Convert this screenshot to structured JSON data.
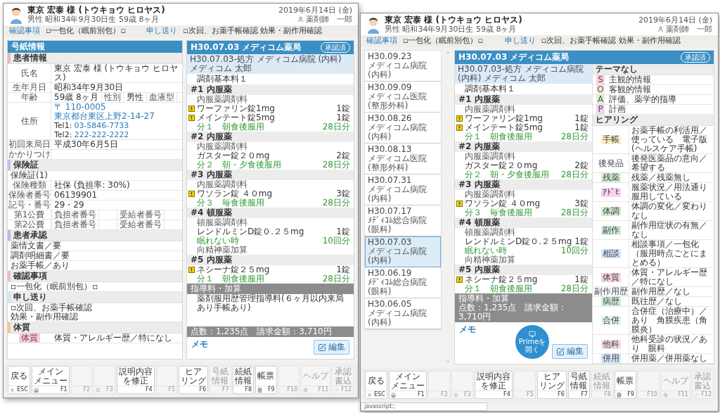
{
  "windows": [
    {
      "kind": "detail",
      "header": {
        "name": "東京 宏泰 様 (トウキョウ ヒロヤス)",
        "info": "男性 昭和34年9月30日生 59歳 8ヶ月",
        "date": "2019年6月14日 (金)",
        "user": "薬剤師　一郎"
      },
      "notes": [
        {
          "label": "確認事項",
          "text": "▫一包化（眠前別包）▫"
        },
        {
          "label": "申し送り",
          "text": "▫次回、お薬手帳確認 効果・副作用確認"
        }
      ],
      "info_panel": {
        "title": "号紙情報",
        "sections": [
          {
            "title": "患者情報",
            "color": "#f4b3bd",
            "rows": [
              {
                "kind": "field",
                "label": "氏名",
                "value": "東京 宏泰 様 (トウキョウ ヒロヤス)"
              },
              {
                "kind": "field",
                "label": "生年月日",
                "value": "昭和34年9月30日"
              },
              {
                "kind": "grid",
                "cells": [
                  {
                    "label": "年齢",
                    "value": "59歳 8ヶ月"
                  },
                  {
                    "label": "性別",
                    "value": "男性"
                  },
                  {
                    "label": "血液型"
                  }
                ]
              },
              {
                "kind": "address",
                "label": "住所",
                "postal": "〒 110-0005",
                "address": "東京都台東区上野2-14-27",
                "tel1_label": "Tel1:",
                "tel1": "03-5846-7733",
                "tel2_label": "Tel2:",
                "tel2": "222-222-2222"
              },
              {
                "kind": "field",
                "label": "初回来局日",
                "value": "平成30年6月5日"
              },
              {
                "kind": "field",
                "label": "かかりつけ"
              }
            ]
          },
          {
            "title": "保険証",
            "color": "#c3c0f0",
            "rows": [
              {
                "kind": "text",
                "text": "保険証(1)"
              },
              {
                "kind": "field",
                "label": "保険種類",
                "value": "社保 (負担率: 30%)"
              },
              {
                "kind": "field",
                "label": "保険者番号",
                "value": "06139901"
              },
              {
                "kind": "field",
                "label": "記号・番号",
                "value": "29・29"
              },
              {
                "kind": "public",
                "label": "第1公費",
                "fields": [
                  "負担者番号",
                  "受給者番号"
                ]
              },
              {
                "kind": "public",
                "label": "第2公費",
                "fields": [
                  "負担者番号",
                  "受給者番号"
                ]
              }
            ]
          },
          {
            "title": "患者承認",
            "color": "#b9b6f2",
            "rows": [
              {
                "kind": "text",
                "text": "薬情文書／要"
              },
              {
                "kind": "text",
                "text": "調剤明細書／要"
              },
              {
                "kind": "text",
                "text": "お薬手帳／あり"
              }
            ]
          },
          {
            "title": "確認事項",
            "color": "#f6b7bf",
            "rows": [
              {
                "kind": "text",
                "text": "▫一包化（眠前別包）▫"
              }
            ]
          },
          {
            "title": "申し送り",
            "color": "#c6eaf6",
            "rows": [
              {
                "kind": "lines",
                "lines": [
                  "▫次回、お薬手帳確認",
                  "効果・副作用確認"
                ]
              }
            ]
          },
          {
            "title": "体質",
            "color": "#f7c58c",
            "rows": [
              {
                "kind": "tag",
                "tag": "体質",
                "color": "#f7cfe0",
                "text": "体質・アレルギー歴／特になし"
              }
            ]
          }
        ]
      },
      "prescription": {
        "title": "H30.07.03 メディコム薬局",
        "badge": "承認済",
        "source": "H30.07.03-処方 メディコム病院 (内科) メディコム 太郎",
        "base": "調剤基本料１",
        "groups": [
          {
            "title": "#1 内服薬",
            "lines": [
              {
                "kind": "fee",
                "text": "内服薬調剤料"
              },
              {
                "kind": "drug",
                "text": "ワーファリン錠1mg",
                "qty": "1錠",
                "warning": true
              },
              {
                "kind": "drug",
                "text": "メインテート錠5mg",
                "qty": "1錠",
                "warning": true
              },
              {
                "kind": "usage",
                "text": "分１　朝食後服用",
                "amount": "28日分"
              }
            ]
          },
          {
            "title": "#2 内服薬",
            "lines": [
              {
                "kind": "fee",
                "text": "内服薬調剤料"
              },
              {
                "kind": "drug",
                "text": "ガスター錠２０mg",
                "qty": "2錠",
                "warning": false
              },
              {
                "kind": "usage",
                "text": "分２　朝・夕食後服用",
                "amount": "28日分"
              }
            ]
          },
          {
            "title": "#3 内服薬",
            "lines": [
              {
                "kind": "fee",
                "text": "内服薬調剤料"
              },
              {
                "kind": "drug",
                "text": "ワソラン錠 ４０mg",
                "qty": "3錠",
                "warning": true
              },
              {
                "kind": "usage",
                "text": "分３　毎食後服用",
                "amount": "28日分"
              }
            ]
          },
          {
            "title": "#4 頓服薬",
            "lines": [
              {
                "kind": "fee",
                "text": "頓服薬調剤料"
              },
              {
                "kind": "drug",
                "text": "レンドルミンD錠０.２５mg",
                "qty": "1錠",
                "warning": false
              },
              {
                "kind": "usage",
                "text": "眠れない時",
                "amount": "10回分"
              },
              {
                "kind": "fee",
                "text": "向精神薬加算"
              }
            ]
          },
          {
            "title": "#5 内服薬",
            "lines": [
              {
                "kind": "drug",
                "text": "ネシーナ錠２５mg",
                "qty": "1錠",
                "warning": true
              },
              {
                "kind": "usage",
                "text": "分１　朝食後服用",
                "amount": "28日分"
              }
            ]
          }
        ],
        "guidance_title": "指導料・加算",
        "guidance": [
          "薬剤服用歴管理指導料(６ヶ月以内来局あり手帳あり)"
        ],
        "total": "点数：1,235点　請求金額：3,710円",
        "memo": "メモ",
        "edit": "編集"
      },
      "function_keys": [
        {
          "label": [
            "戻る"
          ],
          "key": "ESC",
          "disabled": false
        },
        {
          "label": [
            "メイン",
            "メニュー"
          ],
          "key": "F1",
          "disabled": false
        },
        {
          "key": "F2",
          "disabled": true
        },
        {
          "key": "F3",
          "disabled": true
        },
        {
          "label": [
            "説明内容",
            "を修正"
          ],
          "key": "F4",
          "disabled": false
        },
        {
          "key": "F5",
          "disabled": true
        },
        {
          "label": [
            "ヒア",
            "リング"
          ],
          "key": "F6",
          "disabled": false
        },
        {
          "label": [
            "号紙",
            "情報"
          ],
          "key": "F7",
          "disabled": true
        },
        {
          "label": [
            "続紙",
            "情報"
          ],
          "key": "F8",
          "disabled": false
        },
        {
          "label": [
            "帳票"
          ],
          "key": "F9",
          "disabled": false
        },
        {
          "key": "F10",
          "disabled": true
        },
        {
          "label": [
            "ヘルプ"
          ],
          "key": "F11",
          "disabled": true
        },
        {
          "label": [
            "承認",
            "書込"
          ],
          "key": "F12",
          "disabled": true
        }
      ]
    },
    {
      "kind": "history",
      "header": {
        "name": "東京 宏泰 様 (トウキョウ ヒロヤス)",
        "info": "男性 昭和34年9月30日生 59歳 8ヶ月",
        "date": "2019年6月14日 (金)",
        "user": "薬剤師　一郎"
      },
      "notes": [
        {
          "label": "確認事項",
          "text": "▫一包化（眠前別包）▫"
        },
        {
          "label": "申し送り",
          "text": "▫次回、お薬手帳確認 効果・副作用確認"
        }
      ],
      "history": [
        {
          "date": "H30.09.23",
          "clinic": "メディコム病院 (内科)",
          "selected": false
        },
        {
          "date": "H30.09.09",
          "clinic": "メディコム医院 (整形外科)",
          "selected": false
        },
        {
          "date": "H30.08.26",
          "clinic": "メディコム病院 (内科)",
          "selected": false
        },
        {
          "date": "H30.08.13",
          "clinic": "メディコム医院 (整形外科)",
          "selected": false
        },
        {
          "date": "H30.07.31",
          "clinic": "メディコム病院 (内科)",
          "selected": false
        },
        {
          "date": "H30.07.17",
          "clinic": "ﾒﾃﾞｨｺﾑ総合病院 (眼科)",
          "selected": false
        },
        {
          "date": "H30.07.03",
          "clinic": "メディコム病院 (内科)",
          "selected": true
        },
        {
          "date": "H30.06.19",
          "clinic": "ﾒﾃﾞｨｺﾑ総合病院 (眼科)",
          "selected": false
        },
        {
          "date": "H30.06.05",
          "clinic": "メディコム病院 (内科)",
          "selected": false
        }
      ],
      "prescription": {
        "title": "H30.07.03 メディコム薬局",
        "badge": "承認済",
        "source": "H30.07.03-処方 メディコム病院 (内科) メディコム 太郎",
        "base": "調剤基本料１",
        "groups": [
          {
            "title": "#1 内服薬",
            "lines": [
              {
                "kind": "fee",
                "text": "内服薬調剤料"
              },
              {
                "kind": "drug",
                "text": "ワーファリン錠1mg",
                "qty": "1錠",
                "warning": true
              },
              {
                "kind": "drug",
                "text": "メインテート錠5mg",
                "qty": "1錠",
                "warning": true
              },
              {
                "kind": "usage",
                "text": "分１　朝食後服用",
                "amount": "28日分"
              }
            ]
          },
          {
            "title": "#2 内服薬",
            "lines": [
              {
                "kind": "fee",
                "text": "内服薬調剤料"
              },
              {
                "kind": "drug",
                "text": "ガスター錠２０mg",
                "qty": "2錠",
                "warning": false
              },
              {
                "kind": "usage",
                "text": "分２　朝・夕食後服用",
                "amount": "28日分"
              }
            ]
          },
          {
            "title": "#3 内服薬",
            "lines": [
              {
                "kind": "fee",
                "text": "内服薬調剤料"
              },
              {
                "kind": "drug",
                "text": "ワソラン錠 ４０mg",
                "qty": "3錠",
                "warning": true
              },
              {
                "kind": "usage",
                "text": "分３　毎食後服用",
                "amount": "28日分"
              }
            ]
          },
          {
            "title": "#4 頓服薬",
            "lines": [
              {
                "kind": "fee",
                "text": "頓服薬調剤料"
              },
              {
                "kind": "drug",
                "text": "レンドルミンD錠０.２５mg",
                "qty": "1錠",
                "warning": false
              },
              {
                "kind": "usage",
                "text": "眠れない時",
                "amount": "10回分"
              },
              {
                "kind": "fee",
                "text": "向精神薬加算"
              }
            ]
          },
          {
            "title": "#5 内服薬",
            "lines": [
              {
                "kind": "drug",
                "text": "ネシーナ錠２５mg",
                "qty": "1錠",
                "warning": true
              },
              {
                "kind": "usage",
                "text": "分１　朝食後服用",
                "amount": "28日分"
              }
            ]
          }
        ],
        "guidance_title": "指導料・加算",
        "total": "点数：1,235点　請求金額：3,710円",
        "memo": "メモ",
        "prime": "Primeを開く",
        "edit": "編集"
      },
      "soap": {
        "title": "テーマなし",
        "items": [
          {
            "tag": "S",
            "text": "主観的情報",
            "color": "#f9d1e2"
          },
          {
            "tag": "O",
            "text": "客観的情報",
            "color": "#f7ecd9"
          },
          {
            "tag": "A",
            "text": "評価、薬学的指導",
            "color": "#d6f2d4"
          },
          {
            "tag": "P",
            "text": "計画",
            "color": "#f1d5f1"
          }
        ]
      },
      "hearing": {
        "title": "ヒアリング",
        "items": [
          {
            "tag": "手帳",
            "text": "お薬手帳の利活用／使っている　電子版(ヘルスケア手帳)",
            "color": "#fbf0c2"
          },
          {
            "tag": "後発品",
            "text": "後発医薬品の意向／希望する"
          },
          {
            "tag": "残薬",
            "text": "残薬／残薬無し",
            "color": "#d8f2cf"
          },
          {
            "tag": "ｱﾄﾞﾋ",
            "text": "服薬状況／用法通り服用している",
            "color": "#f8d2ee"
          },
          {
            "tag": "体調",
            "text": "体調の変化／変わりなし",
            "color": "#d6f0cf"
          },
          {
            "tag": "副作",
            "text": "副作用症状の有無／なし",
            "color": "#cfeed3"
          },
          {
            "tag": "相談",
            "text": "相談事項／一包化（服用時点ごとにまとめる）",
            "color": "#d4e5f7"
          },
          {
            "tag": "体質",
            "text": "体質・アレルギー歴／特になし",
            "color": "#f8d4db"
          },
          {
            "tag": "副作用歴",
            "text": "副作用歴／なし"
          },
          {
            "tag": "病歴",
            "text": "既往歴／なし",
            "color": "#d3efd7"
          },
          {
            "tag": "合併",
            "text": "合併症（治療中）／あり　角膜疾患（角膜炎）",
            "color": "#dff4ea"
          },
          {
            "tag": "他科",
            "text": "他科受診の状況／あり　眼科",
            "color": "#f8dce6"
          },
          {
            "tag": "併用",
            "text": "併用薬／併用薬なし",
            "color": "#d5e5f8"
          }
        ]
      },
      "function_keys": [
        {
          "label": [
            "戻る"
          ],
          "key": "ESC",
          "disabled": false
        },
        {
          "label": [
            "メイン",
            "メニュー"
          ],
          "key": "F1",
          "disabled": false
        },
        {
          "key": "F2",
          "disabled": true
        },
        {
          "key": "F3",
          "disabled": true
        },
        {
          "label": [
            "説明内容",
            "を修正"
          ],
          "key": "F4",
          "disabled": false
        },
        {
          "key": "F5",
          "disabled": true
        },
        {
          "label": [
            "ヒア",
            "リング"
          ],
          "key": "F6",
          "disabled": false
        },
        {
          "label": [
            "号紙",
            "情報"
          ],
          "key": "F7",
          "disabled": false
        },
        {
          "label": [
            "続紙",
            "情報"
          ],
          "key": "F8",
          "disabled": true
        },
        {
          "label": [
            "帳票"
          ],
          "key": "F9",
          "disabled": false
        },
        {
          "key": "F10",
          "disabled": true
        },
        {
          "label": [
            "ヘルプ"
          ],
          "key": "F11",
          "disabled": true
        },
        {
          "label": [
            "承認",
            "書込"
          ],
          "key": "F12",
          "disabled": true
        }
      ],
      "status_bar": "javascript:;"
    }
  ]
}
